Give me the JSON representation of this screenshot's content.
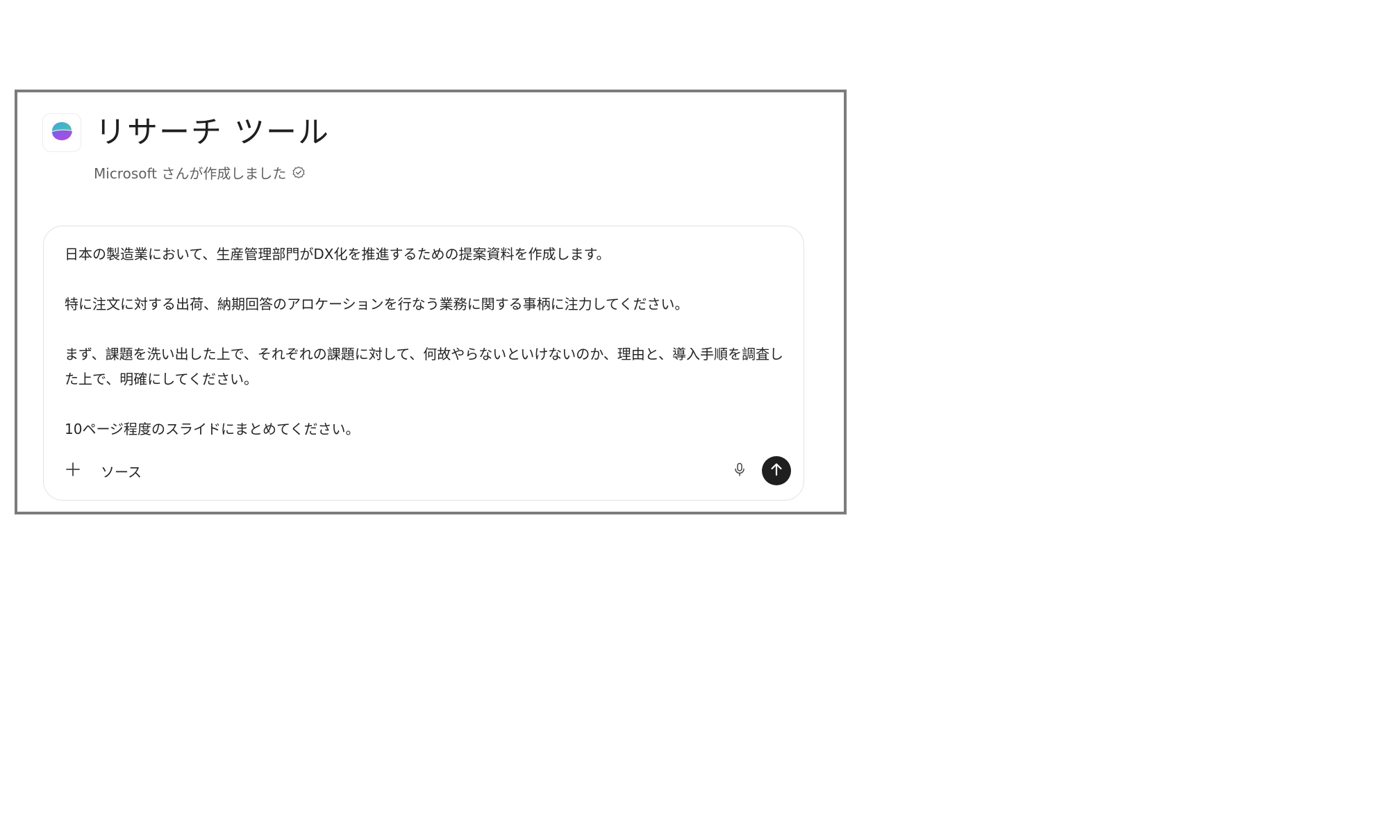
{
  "agent": {
    "title": "リサーチ ツール",
    "subtitle": "Microsoft さんが作成しました",
    "logo_icon": "copilot-logo-icon",
    "verified_icon": "verified-check-icon"
  },
  "composer": {
    "paragraphs": [
      "日本の製造業において、生産管理部門がDX化を推進するための提案資料を作成します。",
      "特に注文に対する出荷、納期回答のアロケーションを行なう業務に関する事柄に注力してください。",
      "まず、課題を洗い出した上で、それぞれの課題に対して、何故やらないといけないのか、理由と、導入手順を調査した上で、明確にしてください。",
      "10ページ程度のスライドにまとめてください。"
    ],
    "toolbar": {
      "add_icon": "plus-icon",
      "source_label": "ソース",
      "mic_icon": "microphone-icon",
      "send_icon": "arrow-up-icon"
    }
  },
  "colors": {
    "frame_border": "#7c7c7c",
    "send_button": "#1f1f1f",
    "text_primary": "#242424",
    "text_secondary": "#616161"
  }
}
